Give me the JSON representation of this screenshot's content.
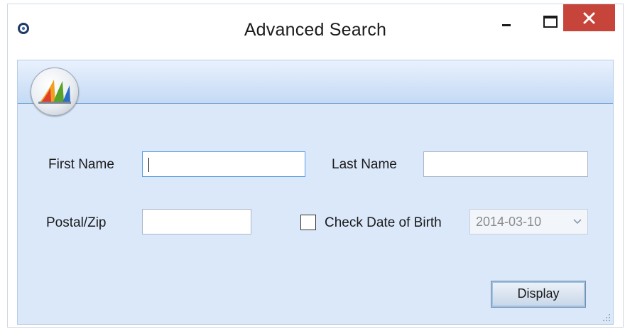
{
  "window": {
    "title": "Advanced Search",
    "icons": {
      "app": "app-logo-icon",
      "minimize": "minimize-icon",
      "maximize": "maximize-icon",
      "close": "close-icon",
      "banner": "dynamics-logo-icon",
      "date_dropdown": "chevron-down-icon",
      "resize": "resize-grip-icon"
    },
    "colors": {
      "close_button": "#c7443a",
      "client_background": "#dbe8fa",
      "focus_border": "#569de5"
    }
  },
  "form": {
    "first_name": {
      "label": "First Name",
      "value": ""
    },
    "last_name": {
      "label": "Last Name",
      "value": ""
    },
    "postal": {
      "label": "Postal/Zip",
      "value": ""
    },
    "dob": {
      "label": "Check Date of Birth",
      "checked": false,
      "date": "2014-03-10"
    },
    "display_button": "Display"
  }
}
